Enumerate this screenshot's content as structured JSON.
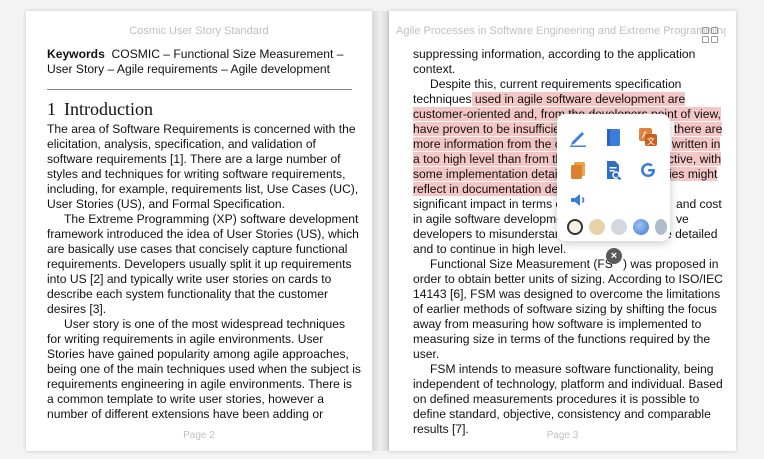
{
  "left_page": {
    "running_header": "Cosmic User Story Standard",
    "keywords_label": "Keywords",
    "keywords_lines": [
      "COSMIC – Functional Size Measurement –",
      "User Story – Agile requirements – Agile development"
    ],
    "section_number": "1",
    "section_title": "Introduction",
    "body_lines": [
      "The area of Software Requirements is concerned with the",
      "elicitation, analysis, specification, and validation of",
      "software requirements [1]. There are a large number of",
      "styles and techniques for writing software requirements,",
      "including, for example, requirements list, Use Cases (UC),",
      "User Stories (US), and Formal Specification.",
      "The Extreme Programming (XP) software development",
      "framework introduced the idea of User Stories (US), which",
      "are basically use cases that concisely capture functional",
      "requirements. Developers usually split it up requirements",
      "into US [2] and typically write user stories on cards to",
      "describe each system functionality that the customer",
      "desires [3].",
      "User story is one of the most widespread techniques",
      "for writing requirements in agile environments. User",
      "Stories have gained popularity among agile approaches,",
      "being one of the main techniques used when the subject is",
      "requirements engineering in agile environments. There is",
      "a common template to write user stories, however a",
      "number of different extensions have been adding or"
    ],
    "page_number": "Page 2"
  },
  "right_page": {
    "running_header": "Agile Processes in Software Engineering and Extreme Programming",
    "lines": [
      {
        "text": "suppressing information, according to the application"
      },
      {
        "text": "context."
      },
      {
        "text": "Despite this, current requirements specification"
      },
      {
        "pre": "techniques",
        "hl": " used in agile software development are"
      },
      {
        "hl": "customer-oriented and, from the devel",
        "gap": "opers point of view,"
      },
      {
        "hl": "have proven to be insufficien",
        "gap2": "t",
        "hl2": "there are"
      },
      {
        "hl": "more information from the c",
        "hl2": "written in"
      },
      {
        "hl": "a too high level than from th",
        "hl2": "ctive, with"
      },
      {
        "hl": "some implementation details",
        "hl2": "ies might"
      },
      {
        "hl": "reflect in documentation deb",
        "post": ""
      },
      {
        "text": "significant impact in terms o",
        "tail": "and cost"
      },
      {
        "text": "in agile software developme",
        "tail": "ve"
      },
      {
        "text": "developers to misunderstan",
        "tail": "e detailed"
      },
      {
        "text": "and to continue in high level."
      },
      {
        "text": "Functional Size Measurement (FS",
        "tail": ") was proposed in"
      },
      {
        "text": "order to obtain better units of sizing. According to ISO/IEC"
      },
      {
        "text": "14143 [6], FSM was designed to overcome the limitations"
      },
      {
        "text": "of earlier methods of software sizing by shifting the focus"
      },
      {
        "text": "away from measuring how software is implemented to"
      },
      {
        "text": "measuring size in terms of the functions required by the"
      },
      {
        "text": "user."
      },
      {
        "text": "FSM intends to measure software functionality, being"
      },
      {
        "text": "independent of technology, platform and individual. Based"
      },
      {
        "text": "on defined measurements procedures it is possible to"
      },
      {
        "text": "define standard, objective, consistency and comparable"
      },
      {
        "text": "results [7]."
      }
    ],
    "page_number": "Page 3"
  },
  "popup": {
    "tools": [
      "pen-icon",
      "notebook-icon",
      "translate-icon",
      "copy-icon",
      "document-search-icon",
      "google-icon",
      "speaker-icon"
    ],
    "swatches": [
      "#f8f1e4",
      "#e8d3a8",
      "#d3d8df",
      "#5c8fd6",
      "#b0bcc9"
    ],
    "close_label": "×"
  },
  "colors": {
    "highlight": "#f4c6c6",
    "page_bg": "#ffffff",
    "header_text": "#c0c0c0"
  }
}
